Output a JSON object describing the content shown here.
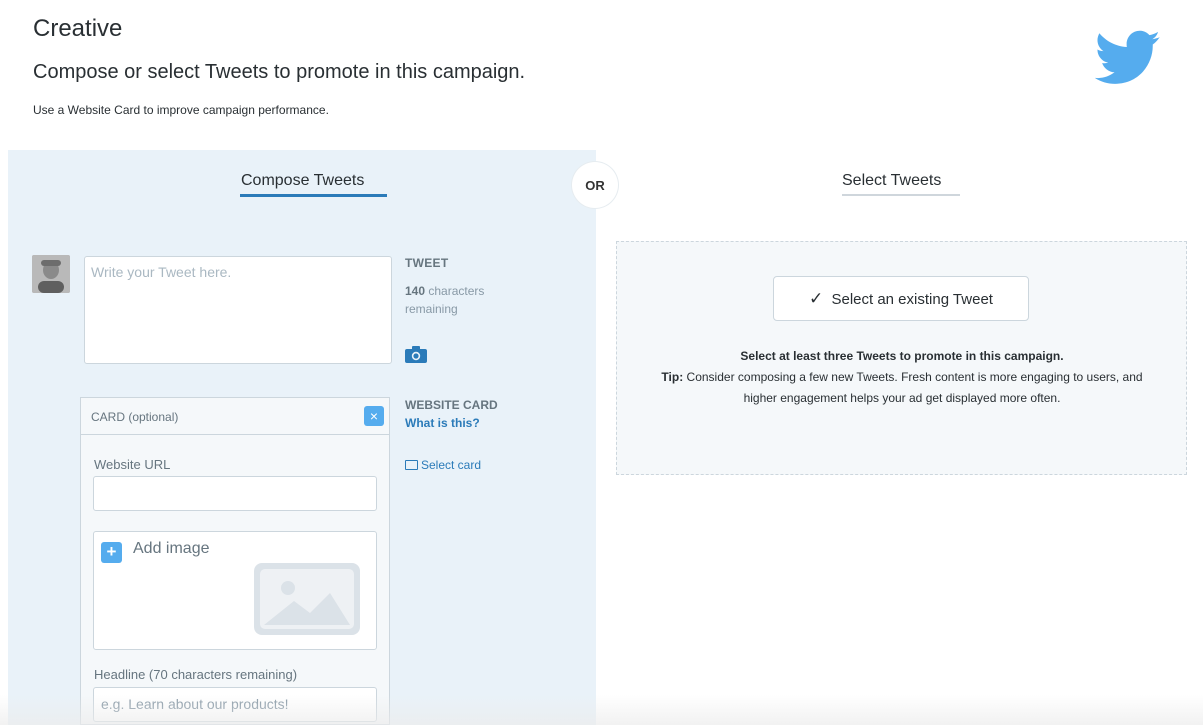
{
  "header": {
    "title": "Creative",
    "subtitle": "Compose or select Tweets to promote in this campaign.",
    "hint": "Use a Website Card to improve campaign performance."
  },
  "tabs": {
    "compose": "Compose Tweets",
    "or": "OR",
    "select": "Select Tweets"
  },
  "compose": {
    "tweet_placeholder": "Write your Tweet here.",
    "tweet_label": "TWEET",
    "chars_count": "140",
    "chars_text": "characters remaining",
    "website_card_label": "WEBSITE CARD",
    "what_is_this": "What is this?",
    "select_card": "Select card"
  },
  "card": {
    "title": "CARD (optional)",
    "close": "×",
    "website_url_label": "Website URL",
    "add_image": "Add image",
    "add_image_glyph": "+",
    "headline_label": "Headline (70 characters remaining)",
    "headline_placeholder": "e.g. Learn about our products!"
  },
  "select": {
    "button_label": "Select an existing Tweet",
    "check": "✓",
    "help_bold": "Select at least three Tweets to promote in this campaign.",
    "tip_label": "Tip:",
    "tip_text": "Consider composing a few new Tweets. Fresh content is more engaging to users, and higher engagement helps your ad get displayed more often."
  },
  "colors": {
    "accent": "#55acee",
    "link": "#2b7bb9",
    "compose_bg": "#e9f2f9"
  },
  "icons": [
    "twitter-bird-icon",
    "camera-icon",
    "close-icon",
    "plus-icon",
    "image-placeholder-icon",
    "card-icon",
    "checkmark-icon"
  ]
}
